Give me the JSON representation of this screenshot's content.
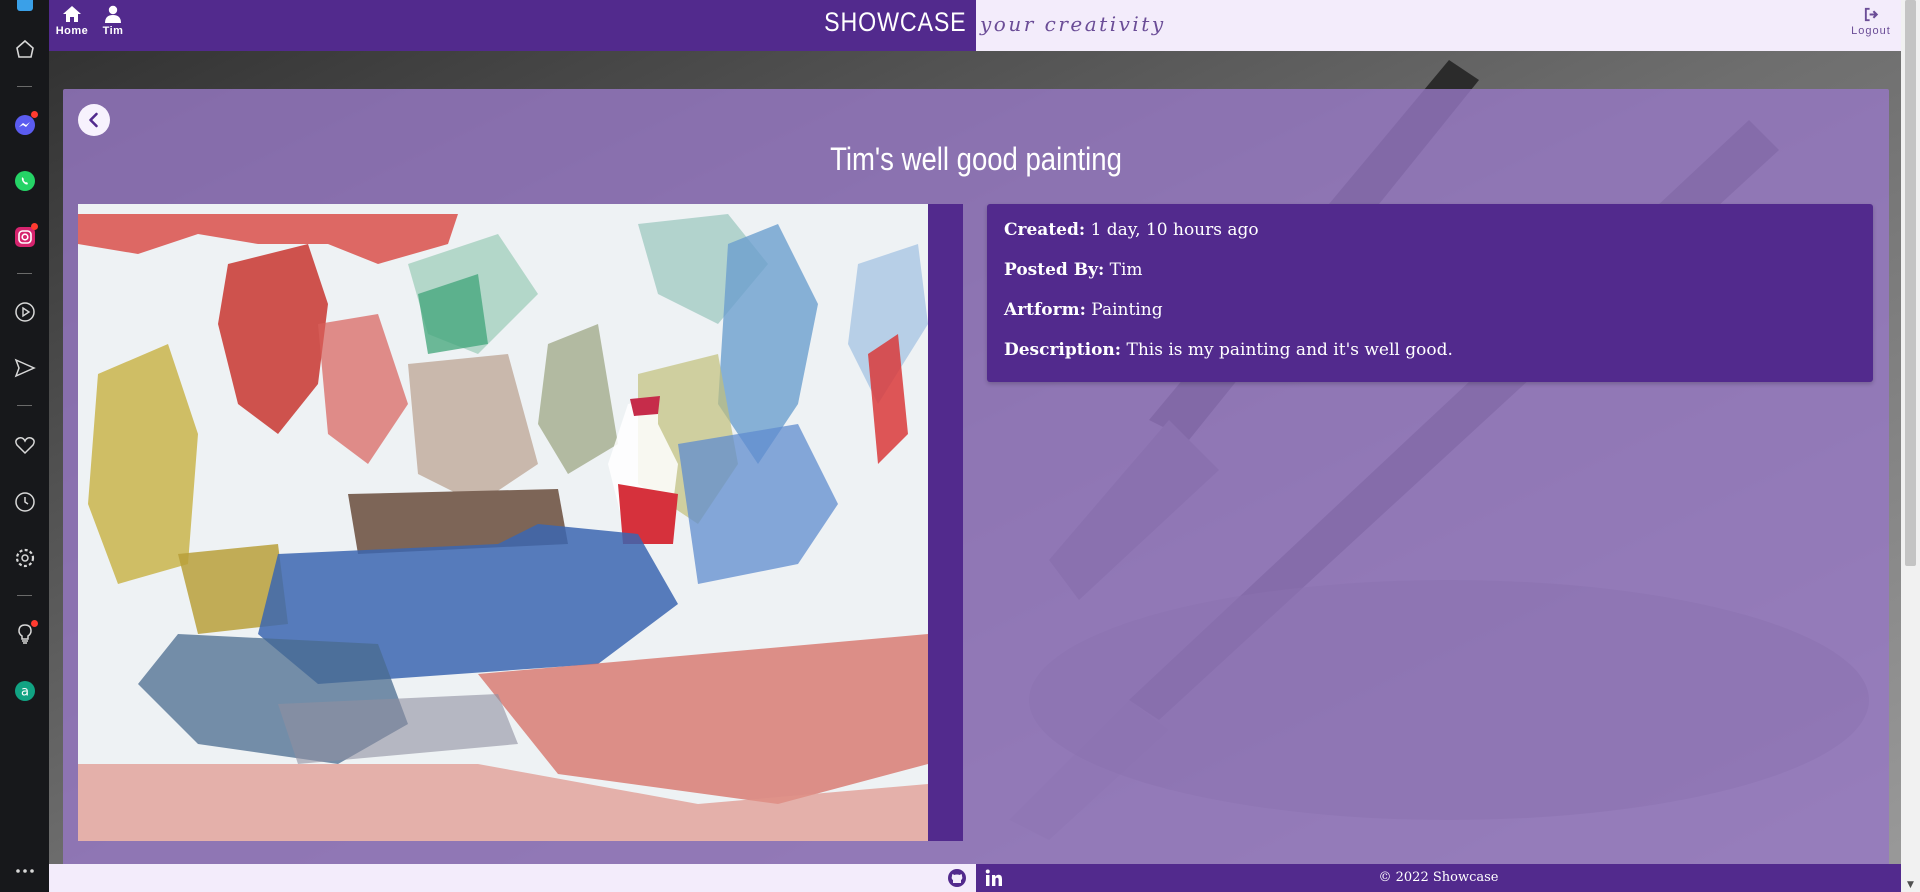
{
  "nav": {
    "home_label": "Home",
    "user_label": "Tim",
    "brand": "SHOWCASE",
    "tagline": "your creativity",
    "logout_label": "Logout"
  },
  "artwork": {
    "title": "Tim's well good painting",
    "fields": [
      {
        "label": "Created:",
        "value": "1 day, 10 hours ago"
      },
      {
        "label": "Posted By:",
        "value": "Tim"
      },
      {
        "label": "Artform:",
        "value": "Painting"
      },
      {
        "label": "Description:",
        "value": "This is my painting and it's well good."
      }
    ]
  },
  "footer": {
    "copyright": "© 2022 Showcase"
  },
  "dock": {
    "items": [
      "app-icon",
      "home-icon",
      "messenger-icon",
      "whatsapp-icon",
      "instagram-icon",
      "play-icon",
      "send-icon",
      "heart-icon",
      "clock-icon",
      "settings-icon",
      "lightbulb-icon",
      "account-icon",
      "more-icon"
    ]
  },
  "colors": {
    "brand_purple": "#522a8d",
    "light_lavender": "#f3ecfb",
    "card_overlay": "#9678c3"
  }
}
